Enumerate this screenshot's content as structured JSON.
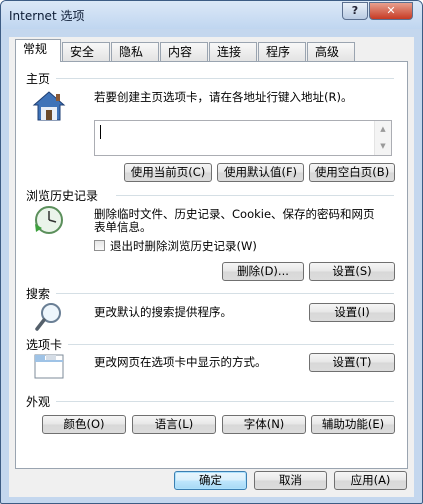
{
  "window": {
    "title": "Internet 选项",
    "help_label": "?",
    "close_label": "✕"
  },
  "tabs": [
    "常规",
    "安全",
    "隐私",
    "内容",
    "连接",
    "程序",
    "高级"
  ],
  "home": {
    "section_label": "主页",
    "description": "若要创建主页选项卡，请在各地址行键入地址(R)。",
    "url_value": "",
    "buttons": {
      "current": "使用当前页(C)",
      "default": "使用默认值(F)",
      "blank": "使用空白页(B)"
    }
  },
  "history": {
    "section_label": "浏览历史记录",
    "description_line1": "删除临时文件、历史记录、Cookie、保存的密码和网页",
    "description_line2": "表单信息。",
    "checkbox_label": "退出时删除浏览历史记录(W)",
    "checkbox_checked": false,
    "buttons": {
      "delete": "删除(D)...",
      "settings": "设置(S)"
    }
  },
  "search": {
    "section_label": "搜索",
    "description": "更改默认的搜索提供程序。",
    "settings_label": "设置(I)"
  },
  "tabs_section": {
    "section_label": "选项卡",
    "description": "更改网页在选项卡中显示的方式。",
    "settings_label": "设置(T)"
  },
  "appearance": {
    "section_label": "外观",
    "buttons": {
      "colors": "颜色(O)",
      "languages": "语言(L)",
      "fonts": "字体(N)",
      "accessibility": "辅助功能(E)"
    }
  },
  "footer": {
    "ok": "确定",
    "cancel": "取消",
    "apply": "应用(A)"
  },
  "colors": {
    "titlebar": "#c4d7ee",
    "close": "#c63a24",
    "accent": "#3c7fb1"
  }
}
